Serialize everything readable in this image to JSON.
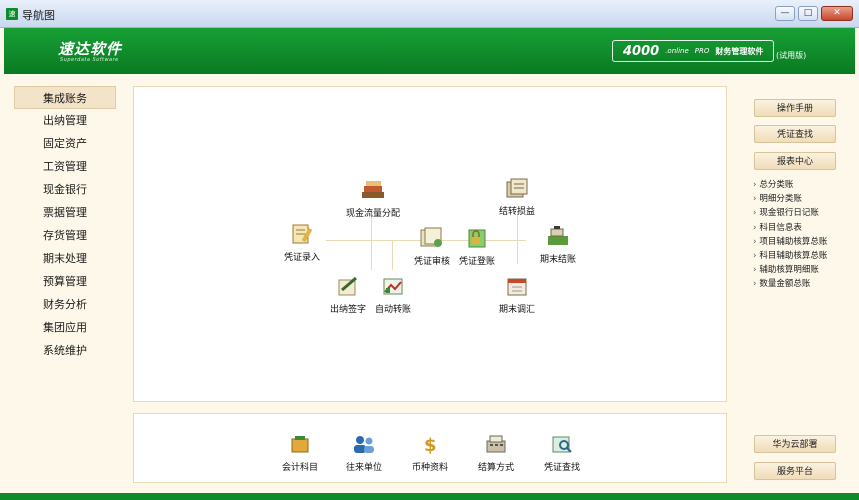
{
  "window": {
    "title": "导航图",
    "app_icon_text": "速",
    "min": "—",
    "max": "□",
    "close": "✕"
  },
  "header": {
    "logo": "速达软件",
    "logo_sub": "Superdata Software",
    "badge_num": "4000",
    "badge_online": ".online",
    "badge_pro": "PRO",
    "badge_name": "财务管理软件",
    "trial": "(试用版)"
  },
  "sidebar": {
    "items": [
      {
        "label": "集成账务",
        "active": true
      },
      {
        "label": "出纳管理"
      },
      {
        "label": "固定资产"
      },
      {
        "label": "工资管理"
      },
      {
        "label": "现金银行"
      },
      {
        "label": "票据管理"
      },
      {
        "label": "存货管理"
      },
      {
        "label": "期末处理"
      },
      {
        "label": "预算管理"
      },
      {
        "label": "财务分析"
      },
      {
        "label": "集团应用"
      },
      {
        "label": "系统维护"
      }
    ]
  },
  "flow": {
    "voucher_entry": "凭证录入",
    "cashflow": "现金流量分配",
    "cashier_sign": "出纳签字",
    "auto_transfer": "自动转账",
    "voucher_audit": "凭证审核",
    "voucher_post": "凭证登账",
    "pnl_transfer": "结转损益",
    "period_adjust": "期末调汇",
    "period_close": "期末结账"
  },
  "quick": {
    "items": [
      "会计科目",
      "往来单位",
      "币种资料",
      "结算方式",
      "凭证查找"
    ]
  },
  "right": {
    "manual": "操作手册",
    "voucher_search": "凭证查找",
    "report_center": "报表中心",
    "reports": [
      "总分类账",
      "明细分类账",
      "现金银行日记账",
      "科目信息表",
      "项目辅助核算总账",
      "科目辅助核算总账",
      "辅助核算明细账",
      "数量金额总账"
    ],
    "cloud": "华为云部署",
    "service": "服务平台"
  }
}
